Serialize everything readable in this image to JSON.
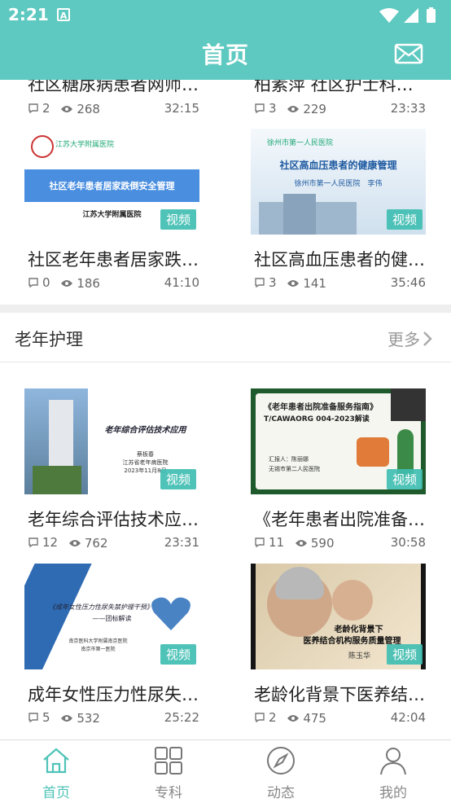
{
  "status_bar": {
    "time": "2:21",
    "notif_letter": "A"
  },
  "header": {
    "title": "首页"
  },
  "top_cards": [
    {
      "title": "社区糖尿病患者网师…",
      "comments": "2",
      "views": "268",
      "duration": "32:15"
    },
    {
      "title": "柏素萍 社区护士科…",
      "comments": "3",
      "views": "229",
      "duration": "23:33"
    },
    {
      "title": "社区老年患者居家跌…",
      "comments": "0",
      "views": "186",
      "duration": "41:10",
      "badge": "视频",
      "thumb": {
        "header": "江苏大学附属医院",
        "banner": "社区老年患者居家跌倒安全管理",
        "footer": "江苏大学附属医院"
      }
    },
    {
      "title": "社区高血压患者的健…",
      "comments": "3",
      "views": "141",
      "duration": "35:46",
      "badge": "视频",
      "thumb": {
        "header": "徐州市第一人民医院",
        "banner": "社区高血压患者的健康管理",
        "footer": "徐州市第一人民医院　李伟"
      }
    }
  ],
  "section": {
    "title": "老年护理",
    "more": "更多"
  },
  "section_cards": [
    {
      "title": "老年综合评估技术应…",
      "comments": "12",
      "views": "762",
      "duration": "23:31",
      "badge": "视频",
      "thumb": {
        "banner": "老年综合评估技术应用",
        "line1": "蔡板春",
        "line2": "江苏省老年病医院",
        "line3": "2023年11月8日"
      }
    },
    {
      "title": "《老年患者出院准备…",
      "comments": "11",
      "views": "590",
      "duration": "30:58",
      "badge": "视频",
      "thumb": {
        "banner": "《老年患者出院准备服务指南》",
        "line1": "T/CAWAORG 004-2023解读",
        "line2": "汇报人：陈丽娜",
        "line3": "无锡市第二人民医院"
      }
    },
    {
      "title": "成年女性压力性尿失…",
      "comments": "5",
      "views": "532",
      "duration": "25:22",
      "badge": "视频",
      "thumb": {
        "banner": "《成年女性压力性尿失禁护理干预》",
        "line1": "——团标解读",
        "line2": "南京医科大学附属南京医院",
        "line3": "南京市第一医院"
      }
    },
    {
      "title": "老龄化背景下医养结…",
      "comments": "2",
      "views": "475",
      "duration": "42:04",
      "badge": "视频",
      "thumb": {
        "banner": "老龄化背景下",
        "line1": "医养结合机构服务质量管理",
        "line2": "陈玉华"
      }
    }
  ],
  "tabs": [
    {
      "label": "首页",
      "icon": "home-icon",
      "active": true
    },
    {
      "label": "专科",
      "icon": "grid-icon",
      "active": false
    },
    {
      "label": "动态",
      "icon": "compass-icon",
      "active": false
    },
    {
      "label": "我的",
      "icon": "person-icon",
      "active": false
    }
  ],
  "colors": {
    "primary": "#5ec9c0",
    "active_tab": "#4fc3b7",
    "badge": "#40beb2",
    "text": "#222222",
    "meta": "#666666"
  }
}
